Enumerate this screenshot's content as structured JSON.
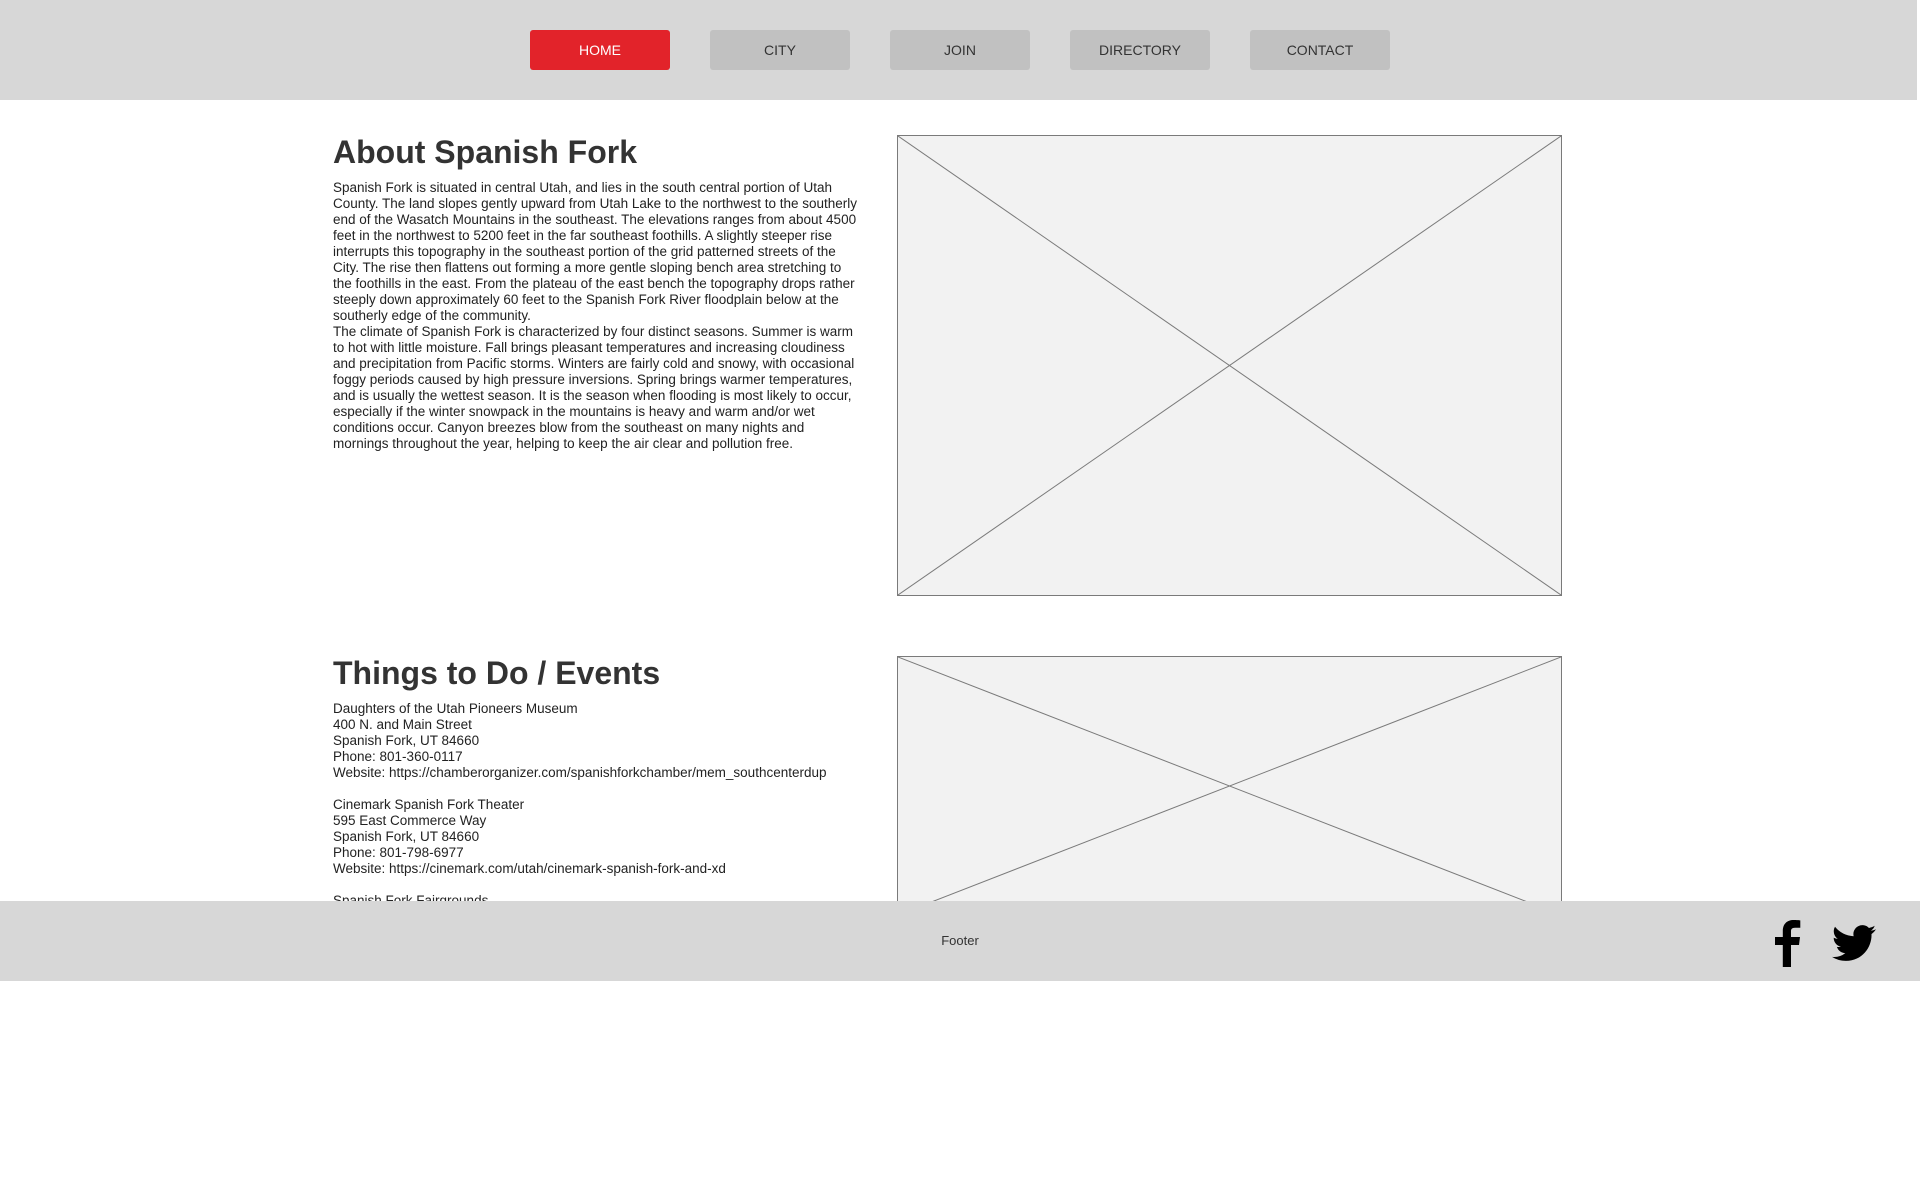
{
  "nav": {
    "items": [
      {
        "label": "HOME",
        "active": true
      },
      {
        "label": "CITY",
        "active": false
      },
      {
        "label": "JOIN",
        "active": false
      },
      {
        "label": "DIRECTORY",
        "active": false
      },
      {
        "label": "CONTACT",
        "active": false
      }
    ]
  },
  "about": {
    "title": "About Spanish Fork",
    "paragraphs": [
      "Spanish Fork is situated in central Utah, and lies in the south central portion of Utah County. The land slopes gently upward from Utah Lake to the northwest to the southerly end of the Wasatch Mountains in the southeast. The elevations ranges from about 4500 feet in the northwest to 5200 feet in the far southeast foothills. A slightly steeper rise interrupts this topography in the southeast portion of the grid patterned streets of the City. The rise then flattens out forming a more gentle sloping bench area stretching to the foothills in the east. From the plateau of the east bench the topography drops rather steeply down approximately 60 feet to the Spanish Fork River floodplain below at the southerly edge of the community.",
      "The climate of Spanish Fork is characterized by four distinct seasons. Summer is warm to hot with little moisture. Fall brings pleasant temperatures and increasing cloudiness and precipitation from Pacific storms. Winters are fairly cold and snowy, with occasional foggy periods caused by high pressure inversions. Spring brings warmer temperatures, and is usually the wettest season. It is the season when flooding is most likely to occur, especially if the winter snowpack in the mountains is heavy and warm and/or wet conditions occur. Canyon breezes blow from the southeast on many nights and mornings throughout the year, helping to keep the air clear and pollution free."
    ]
  },
  "events": {
    "title": "Things to Do / Events",
    "listings": [
      {
        "name": "Daughters of the Utah Pioneers Museum",
        "address": "400 N. and Main Street",
        "city": "Spanish Fork, UT 84660",
        "phone": "Phone: 801-360-0117",
        "website": "Website: https://chamberorganizer.com/spanishforkchamber/mem_southcenterdup"
      },
      {
        "name": "Cinemark Spanish Fork Theater",
        "address": "595 East Commerce Way",
        "city": "Spanish Fork, UT 84660",
        "phone": "Phone: 801-798-6977",
        "website": "Website: https://cinemark.com/utah/cinemark-spanish-fork-and-xd"
      },
      {
        "name": "Spanish Fork Fairgrounds"
      }
    ]
  },
  "footer": {
    "text": "Footer",
    "social": [
      "facebook-icon",
      "twitter-icon"
    ]
  },
  "colors": {
    "accent": "#e2232a",
    "bar": "#d7d7d7",
    "button": "#c1c1c1",
    "placeholder_fill": "#f2f2f2",
    "placeholder_stroke": "#7a7a7a"
  }
}
